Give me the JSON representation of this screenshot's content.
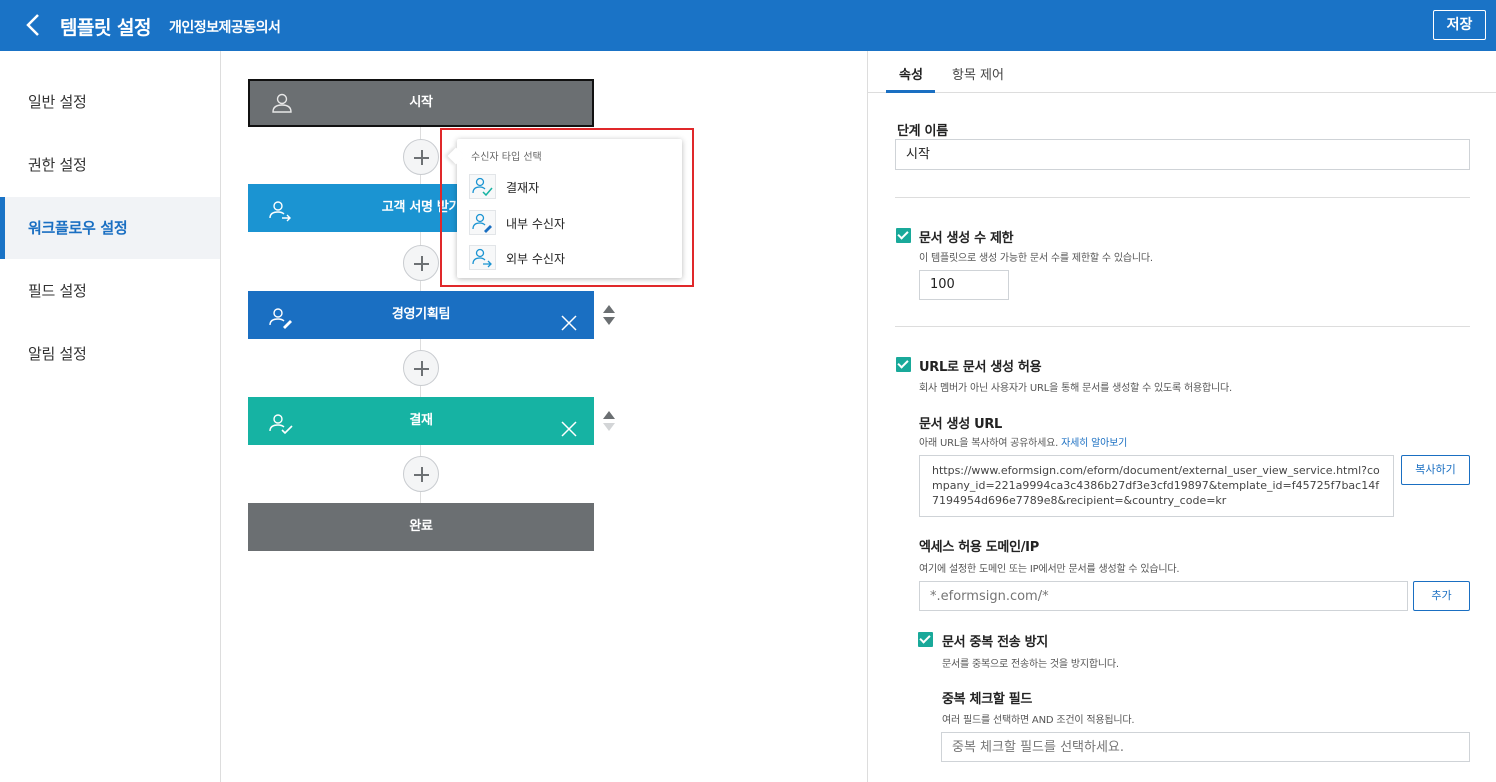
{
  "header": {
    "title": "템플릿 설정",
    "subtitle": "개인정보제공동의서",
    "save_label": "저장"
  },
  "sidebar": {
    "items": [
      {
        "label": "일반 설정"
      },
      {
        "label": "권한 설정"
      },
      {
        "label": "워크플로우 설정",
        "active": true
      },
      {
        "label": "필드 설정"
      },
      {
        "label": "알림 설정"
      }
    ]
  },
  "workflow": {
    "steps": [
      {
        "label": "시작",
        "icon": "user-icon"
      },
      {
        "label": "고객 서명 받기",
        "icon": "send-user-icon"
      },
      {
        "label": "경영기획팀",
        "icon": "edit-user-icon"
      },
      {
        "label": "결재",
        "icon": "approve-user-icon"
      },
      {
        "label": "완료"
      }
    ],
    "popup": {
      "title": "수신자 타입 선택",
      "items": [
        {
          "label": "결재자",
          "icon": "approver-icon"
        },
        {
          "label": "내부 수신자",
          "icon": "internal-recipient-icon"
        },
        {
          "label": "외부 수신자",
          "icon": "external-recipient-icon"
        }
      ]
    }
  },
  "panel": {
    "tabs": [
      {
        "label": "속성",
        "active": true
      },
      {
        "label": "항목 제어"
      }
    ],
    "step_name_label": "단계 이름",
    "step_name_value": "시작",
    "limit": {
      "label": "문서 생성 수 제한",
      "desc": "이 템플릿으로 생성 가능한 문서 수를 제한할 수 있습니다.",
      "value": "100",
      "checked": true
    },
    "url_allow": {
      "label": "URL로 문서 생성 허용",
      "desc": "회사 멤버가 아닌 사용자가 URL을 통해 문서를 생성할 수 있도록 허용합니다.",
      "checked": true
    },
    "doc_url": {
      "label": "문서 생성 URL",
      "desc": "아래 URL을 복사하여 공유하세요.",
      "link": "자세히 알아보기",
      "value": "https://www.eformsign.com/eform/document/external_user_view_service.html?company_id=221a9994ca3c4386b27df3e3cfd19897&template_id=f45725f7bac14f7194954d696e7789e8&recipient=&country_code=kr",
      "copy_label": "복사하기"
    },
    "access": {
      "label": "엑세스 허용 도메인/IP",
      "desc": "여기에 설정한 도메인 또는 IP에서만 문서를 생성할 수 있습니다.",
      "placeholder": "*.eformsign.com/*",
      "add_label": "추가"
    },
    "dup": {
      "label": "문서 중복 전송 방지",
      "desc": "문서를 중복으로 전송하는 것을 방지합니다.",
      "checked": true
    },
    "dup_field": {
      "label": "중복 체크할 필드",
      "desc": "여러 필드를 선택하면 AND 조건이 적용됩니다.",
      "placeholder": "중복 체크할 필드를 선택하세요."
    }
  },
  "colors": {
    "primary": "#1a73c6",
    "step_blue_light": "#1b94d2",
    "step_blue": "#1a6fc2",
    "step_teal": "#16b3a3",
    "step_gray": "#6b6f72",
    "check": "#19a99a",
    "highlight": "#e0282a"
  }
}
